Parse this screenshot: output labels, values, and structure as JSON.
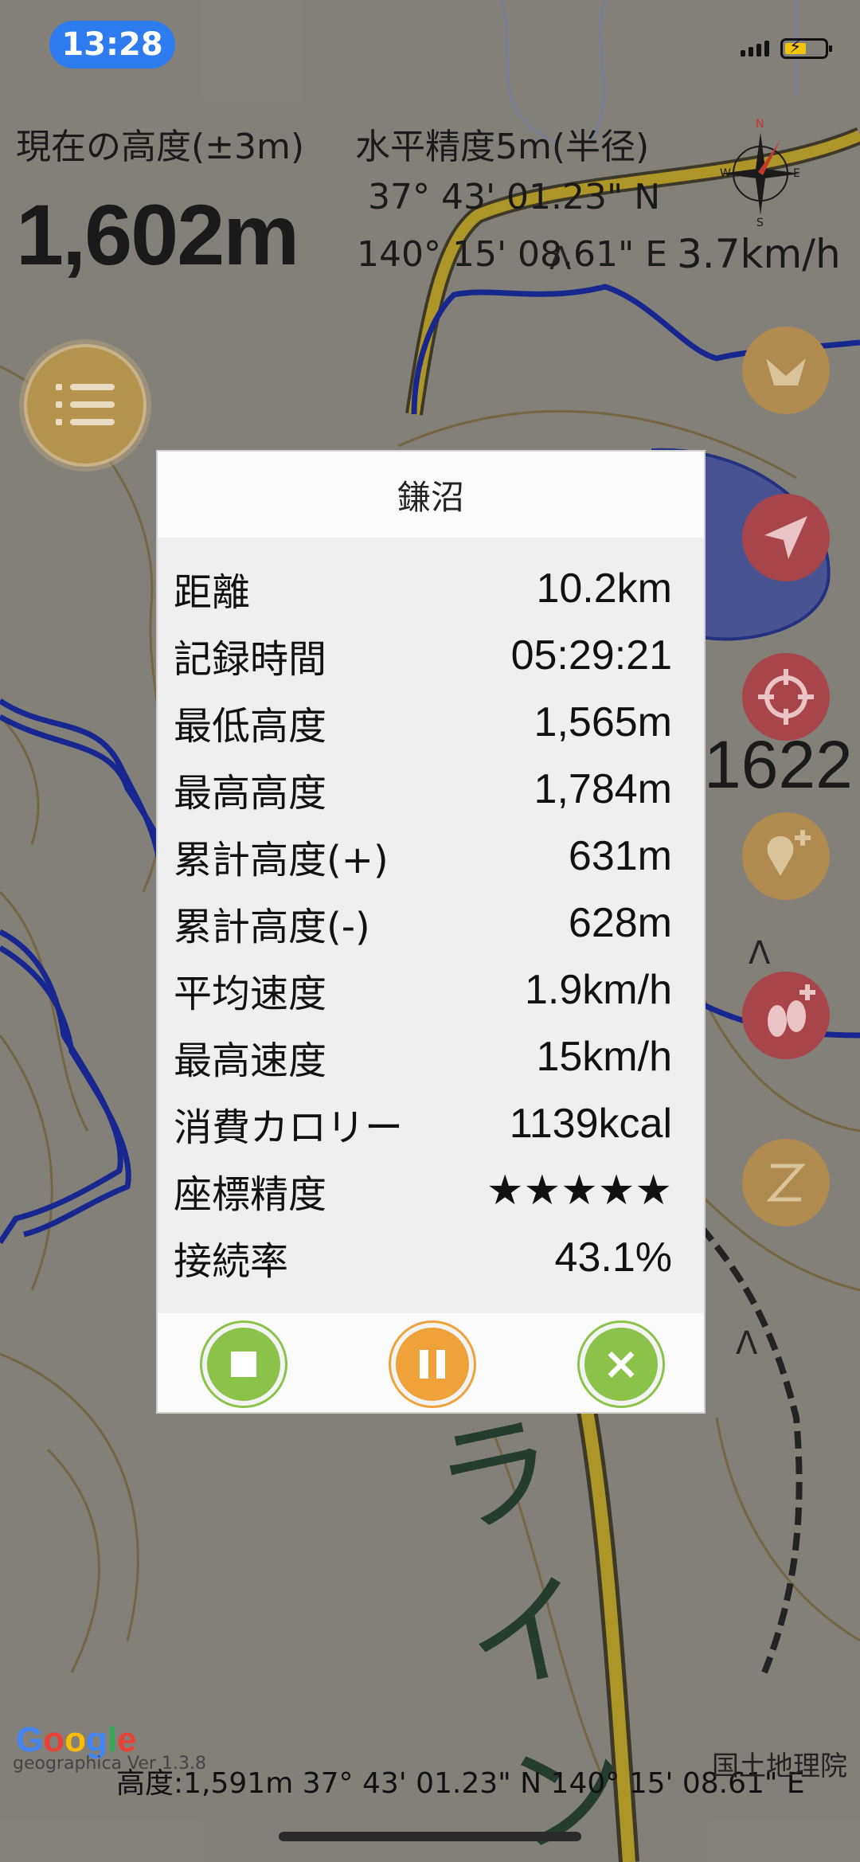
{
  "status": {
    "time": "13:28"
  },
  "hud": {
    "altitude_label": "現在の高度(±3m)",
    "altitude_value": "1,602m",
    "horizontal_accuracy_label": "水平精度5m(半径)",
    "latitude": "37° 43' 01.23\" N",
    "longitude": "140° 15' 08.61\" E",
    "speed": "3.7km/h"
  },
  "compass": {
    "n": "N",
    "e": "E",
    "s": "S",
    "w": "W"
  },
  "map_label": "1622",
  "dialog": {
    "title": "鎌沼",
    "rows": [
      {
        "label": "距離",
        "value": "10.2km"
      },
      {
        "label": "記録時間",
        "value": "05:29:21"
      },
      {
        "label": "最低高度",
        "value": "1,565m"
      },
      {
        "label": "最高高度",
        "value": "1,784m"
      },
      {
        "label": "累計高度(+)",
        "value": "631m"
      },
      {
        "label": "累計高度(-)",
        "value": "628m"
      },
      {
        "label": "平均速度",
        "value": "1.9km/h"
      },
      {
        "label": "最高速度",
        "value": "15km/h"
      },
      {
        "label": "消費カロリー",
        "value": "1139kcal"
      },
      {
        "label": "座標精度",
        "value": "★★★★★"
      },
      {
        "label": "接続率",
        "value": "43.1%"
      }
    ]
  },
  "footer": {
    "coords": "高度:1,591m  37° 43' 01.23\" N 140° 15' 08.61\" E",
    "google": "Google",
    "version": "geographica Ver 1.3.8",
    "attribution": "国土地理院"
  },
  "colors": {
    "accent_green": "#8bc34a",
    "accent_orange": "#f0a23a",
    "status_blue": "#2f7bf0",
    "track_blue": "#0d1e9e"
  }
}
